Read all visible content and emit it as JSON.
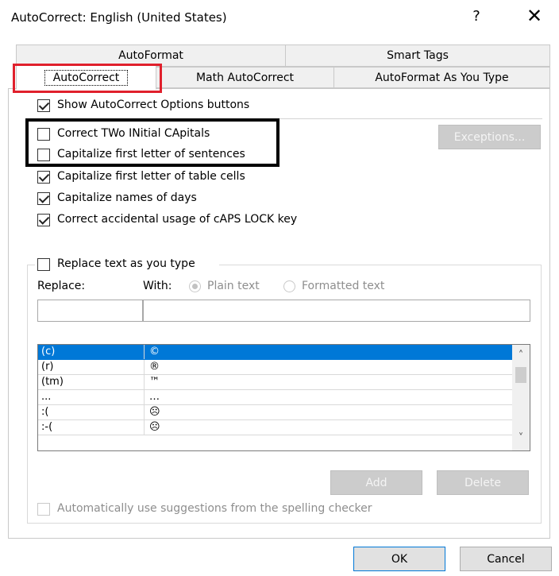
{
  "window": {
    "title": "AutoCorrect: English (United States)",
    "help": "?",
    "close": "✕"
  },
  "tabs": {
    "autoformat": "AutoFormat",
    "smart_tags": "Smart Tags",
    "autocorrect": "AutoCorrect",
    "math_autocorrect": "Math AutoCorrect",
    "autoformat_as_you_type": "AutoFormat As You Type"
  },
  "options": {
    "show_buttons": {
      "label": "Show AutoCorrect Options buttons",
      "checked": true
    },
    "two_initial_caps": {
      "label": "Correct TWo INitial CApitals",
      "checked": false
    },
    "capitalize_sentences": {
      "label": "Capitalize first letter of sentences",
      "checked": false
    },
    "capitalize_table_cells": {
      "label": "Capitalize first letter of table cells",
      "checked": true
    },
    "capitalize_days": {
      "label": "Capitalize names of days",
      "checked": true
    },
    "caps_lock": {
      "label": "Correct accidental usage of cAPS LOCK key",
      "checked": true
    }
  },
  "exceptions_label": "Exceptions...",
  "replace_section": {
    "toggle_label": "Replace text as you type",
    "replace_label": "Replace:",
    "with_label": "With:",
    "plain_text": "Plain text",
    "formatted_text": "Formatted text",
    "replace_value": "",
    "with_value": ""
  },
  "entries": [
    {
      "replace": "(c)",
      "with": "©"
    },
    {
      "replace": "(r)",
      "with": "®"
    },
    {
      "replace": "(tm)",
      "with": "™"
    },
    {
      "replace": "...",
      "with": "…"
    },
    {
      "replace": ":(",
      "with": "☹"
    },
    {
      "replace": ":-(",
      "with": "☹"
    }
  ],
  "add_label": "Add",
  "delete_label": "Delete",
  "spelling_suggestions_label": "Automatically use suggestions from the spelling checker",
  "ok_label": "OK",
  "cancel_label": "Cancel"
}
